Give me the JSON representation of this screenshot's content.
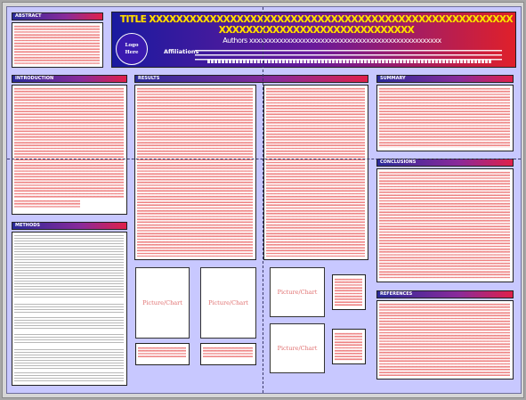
{
  "poster": {
    "title": "TITLE XXXXXXXXXXXXXXXXXXXXXXXXXXXXXXXXXXXXXXXXXXXXXXXXXXXXXXXXXXXXXXXXXXXXXXXXXXXXXXXXXXX",
    "logo_line1": "Logo",
    "logo_line2": "Here",
    "authors": "Authors xxxxxxxxxxxxxxxxxxxxxxxxxxxxxxxxxxxxxxxxxxxxxxxxxxx",
    "affiliations_label": "Affiliations"
  },
  "sections": {
    "abstract": "ABSTRACT",
    "introduction": "INTRODUCTION",
    "methods": "METHODS",
    "results": "RESULTS",
    "summary": "SUMMARY",
    "conclusions": "CONCLUSIONS",
    "references": "REFERENCES"
  },
  "placeholders": {
    "picture_chart": "Picture/Chart"
  },
  "colors": {
    "background": "#c8c8ff",
    "header_gradient_start": "#2a2a9a",
    "header_gradient_end": "#e0204a",
    "title_color": "#ffe000",
    "squiggle": "#e02020"
  }
}
